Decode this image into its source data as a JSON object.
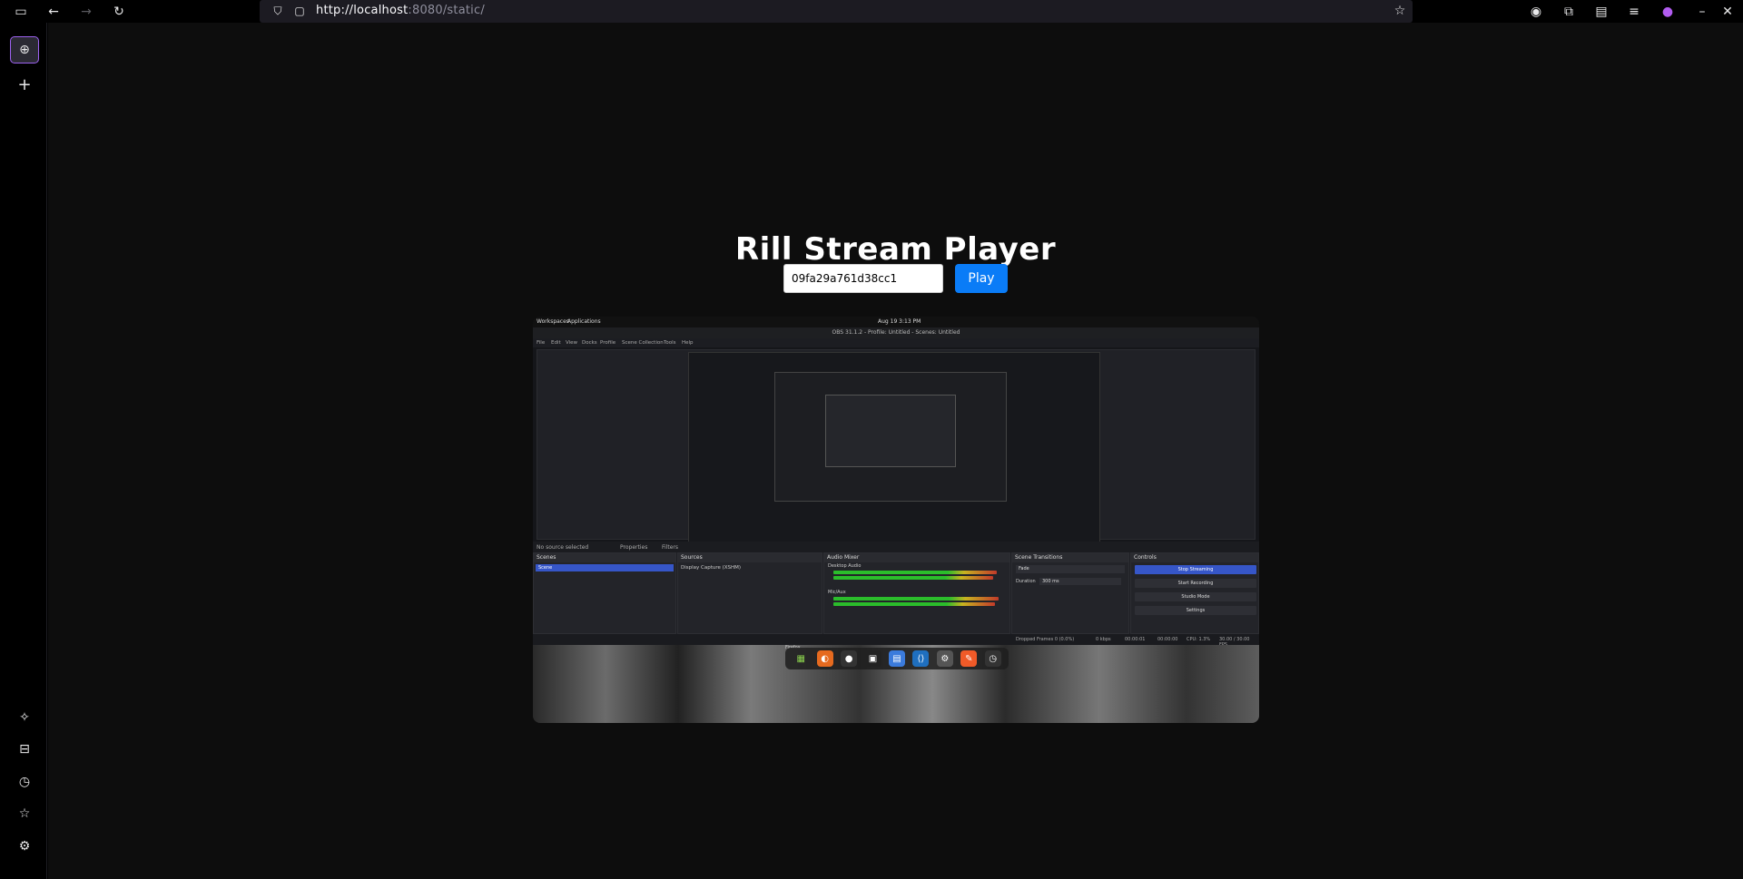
{
  "browser": {
    "url_host": "http://localhost",
    "url_rest": ":8080/static/",
    "nav": {
      "back": "←",
      "forward": "→",
      "reload": "↻"
    }
  },
  "page": {
    "title": "Rill Stream Player",
    "stream_id_value": "09fa29a761d38cc1",
    "play_label": "Play"
  },
  "video": {
    "top_workspaces": "Workspaces",
    "top_applications": "Applications",
    "top_clock": "Aug 19   3:13 PM",
    "window_title": "OBS 31.1.2 - Profile: Untitled - Scenes: Untitled",
    "menu": [
      "File",
      "Edit",
      "View",
      "Docks",
      "Profile",
      "Scene Collection",
      "Tools",
      "Help"
    ],
    "scene_label": "No source selected",
    "scene_properties": "Properties",
    "scene_filters": "Filters",
    "panels": {
      "scenes_title": "Scenes",
      "scenes_item": "Scene",
      "sources_title": "Sources",
      "sources_item": "Display Capture (XSHM)",
      "mixer_title": "Audio Mixer",
      "mixer_ch1": "Desktop Audio",
      "mixer_ch2": "Mic/Aux",
      "transitions_title": "Scene Transitions",
      "transitions_fade": "Fade",
      "transitions_duration_label": "Duration",
      "transitions_duration": "300 ms",
      "controls_title": "Controls",
      "controls": [
        "Stop Streaming",
        "Start Recording",
        "Studio Mode",
        "Settings"
      ]
    },
    "status": {
      "dropped": "Dropped Frames 0 (0.0%)",
      "kbps": "0 kbps",
      "time1": "00:00:01",
      "time2": "00:00:00",
      "cpu": "CPU: 1.3%",
      "fps": "30.00 / 30.00 FPS"
    },
    "dock_label": "Firefox"
  },
  "sidebar": {
    "icons": [
      "ai-chatbot-icon",
      "synced-tabs-icon",
      "history-icon",
      "bookmarks-icon",
      "settings-icon"
    ]
  }
}
